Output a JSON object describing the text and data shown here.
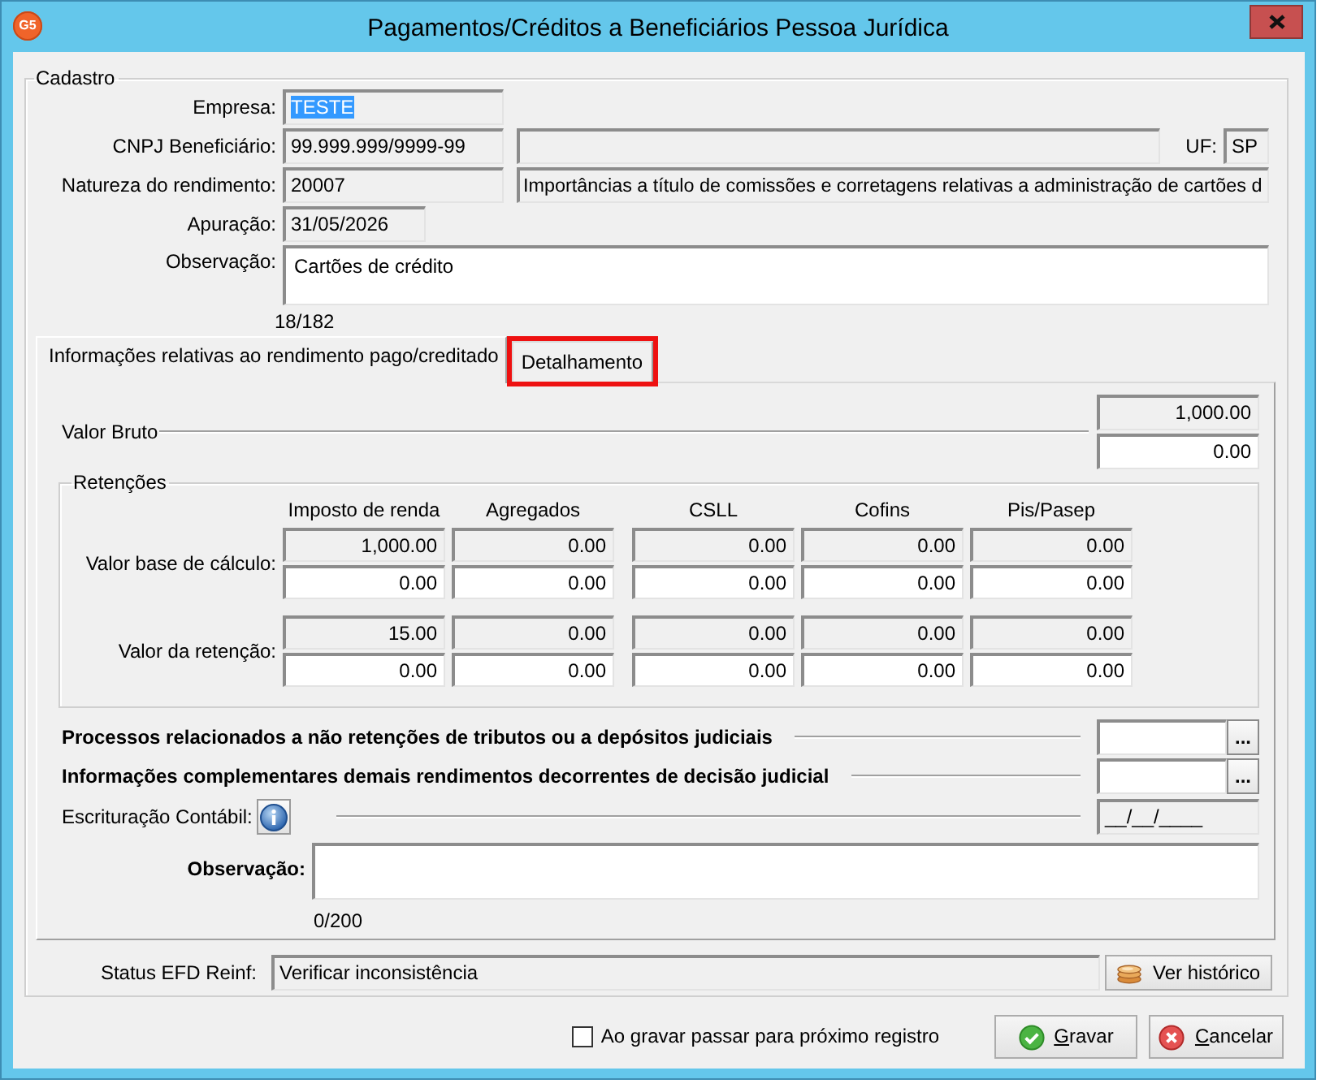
{
  "window": {
    "title": "Pagamentos/Créditos a Beneficiários Pessoa Jurídica",
    "logo": "G5"
  },
  "cadastro": {
    "legend": "Cadastro",
    "empresa": {
      "label": "Empresa:",
      "value": "TESTE",
      "text_selected": true
    },
    "cnpj": {
      "label": "CNPJ Beneficiário:",
      "value": "99.999.999/9999-99"
    },
    "uf": {
      "label": "UF:",
      "value": "SP"
    },
    "natureza": {
      "label": "Natureza do rendimento:",
      "code": "20007",
      "description": "Importâncias a título de comissões e corretagens relativas a administração de cartões d"
    },
    "apuracao": {
      "label": "Apuração:",
      "value": "31/05/2026"
    },
    "observacao": {
      "label": "Observação:",
      "value": "Cartões de crédito",
      "counter": "18/182"
    }
  },
  "tabs": [
    {
      "label": "Informações relativas ao rendimento pago/creditado",
      "selected": true,
      "highlighted": false
    },
    {
      "label": "Detalhamento",
      "selected": false,
      "highlighted": true
    }
  ],
  "panel": {
    "valor_bruto": {
      "label": "Valor Bruto",
      "computed": "1,000.00",
      "entered": "0.00"
    },
    "retencoes": {
      "legend": "Retenções",
      "columns": [
        "Imposto de renda",
        "Agregados",
        "CSLL",
        "Cofins",
        "Pis/Pasep"
      ],
      "rows": [
        {
          "label": "Valor base de cálculo:",
          "computed": [
            "1,000.00",
            "0.00",
            "0.00",
            "0.00",
            "0.00"
          ],
          "entered": [
            "0.00",
            "0.00",
            "0.00",
            "0.00",
            "0.00"
          ]
        },
        {
          "label": "Valor da retenção:",
          "computed": [
            "15.00",
            "0.00",
            "0.00",
            "0.00",
            "0.00"
          ],
          "entered": [
            "0.00",
            "0.00",
            "0.00",
            "0.00",
            "0.00"
          ]
        }
      ]
    },
    "lookups": [
      {
        "label": "Processos relacionados a não retenções de tributos ou a depósitos judiciais",
        "button": "..."
      },
      {
        "label": "Informações complementares demais rendimentos decorrentes de decisão judicial",
        "button": "..."
      }
    ],
    "escrituracao": {
      "label": "Escrituração Contábil:",
      "value": "__/__/____"
    },
    "observacao": {
      "label": "Observação:",
      "counter": "0/200"
    }
  },
  "status": {
    "label": "Status EFD Reinf:",
    "value": "Verificar inconsistência",
    "button": "Ver histórico"
  },
  "footer": {
    "checkbox": {
      "label": "Ao gravar passar para próximo registro",
      "checked": false
    },
    "buttons": [
      {
        "kind": "save",
        "label": "Gravar"
      },
      {
        "kind": "cancel",
        "label": "Cancelar"
      }
    ]
  }
}
